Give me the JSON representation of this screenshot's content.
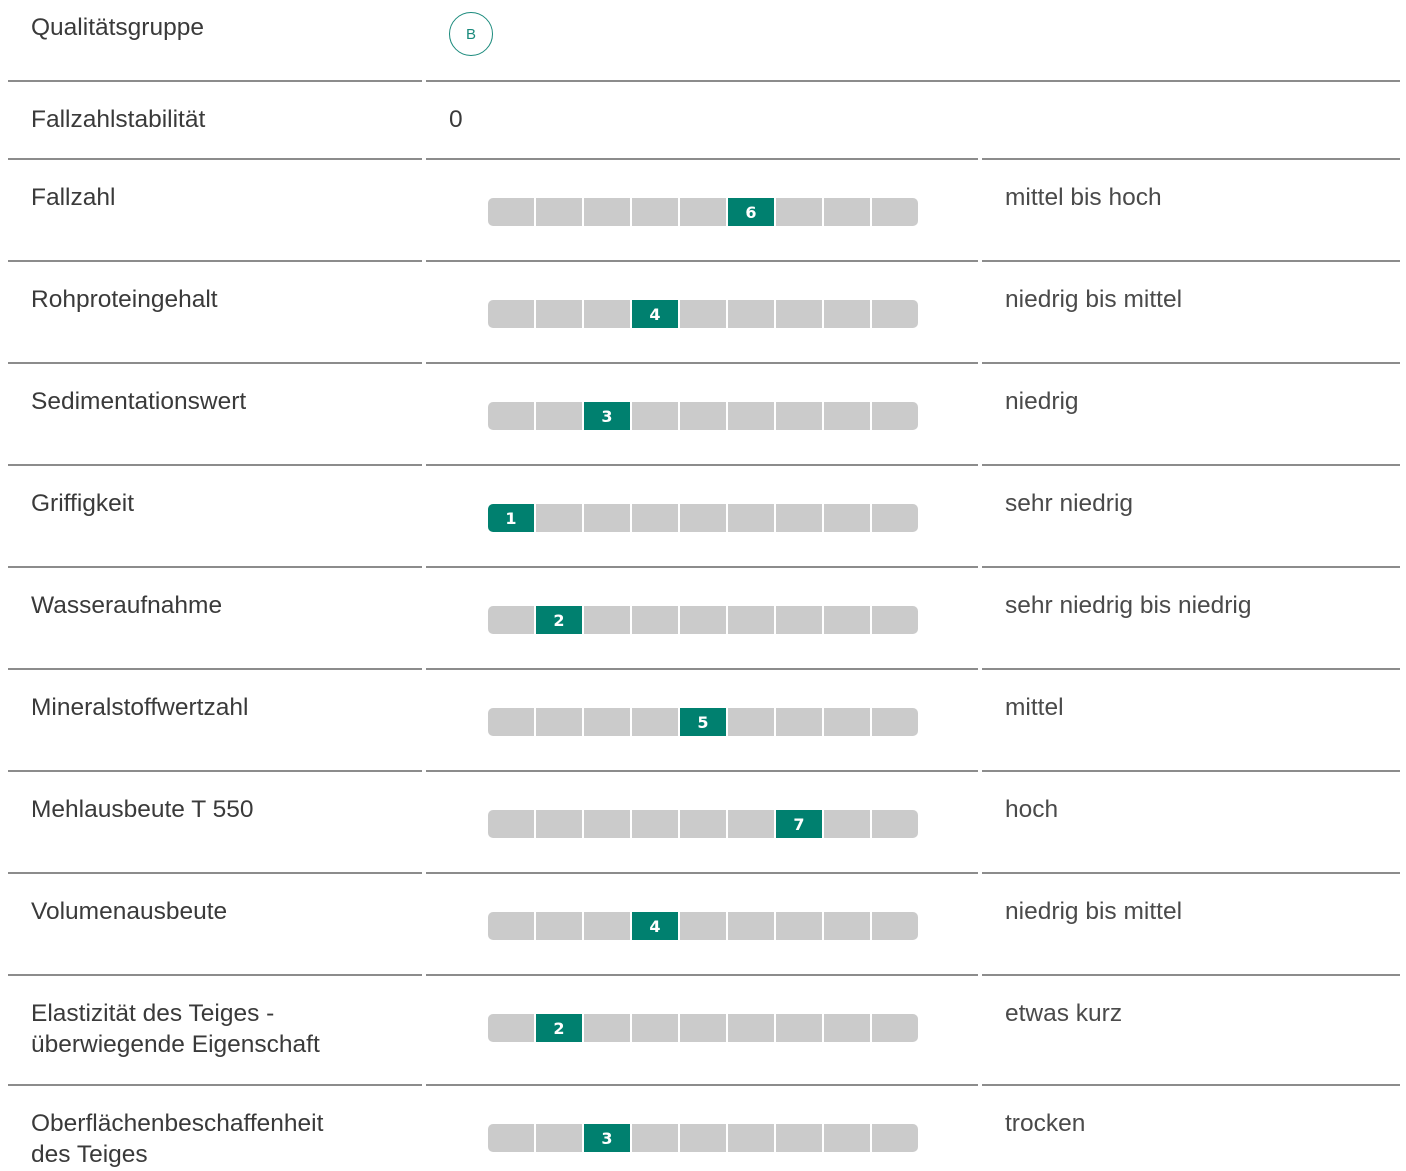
{
  "accent_color": "#00806f",
  "scale_max": 9,
  "rows": [
    {
      "label": "Qualitätsgruppe",
      "badge": "B"
    },
    {
      "label": "Fallzahlstabilität",
      "value": "0"
    },
    {
      "label": "Fallzahl",
      "score": 6,
      "score_label": "6",
      "desc": "mittel bis hoch"
    },
    {
      "label": "Rohproteingehalt",
      "score": 4,
      "score_label": "4",
      "desc": "niedrig bis mittel"
    },
    {
      "label": "Sedimentationswert",
      "score": 3,
      "score_label": "3",
      "desc": "niedrig"
    },
    {
      "label": "Griffigkeit",
      "score": 1,
      "score_label": "1",
      "desc": "sehr niedrig"
    },
    {
      "label": "Wasseraufnahme",
      "score": 2,
      "score_label": "2",
      "desc": "sehr niedrig bis niedrig"
    },
    {
      "label": "Mineralstoffwertzahl",
      "score": 5,
      "score_label": "5",
      "desc": "mittel"
    },
    {
      "label": "Mehlausbeute T 550",
      "score": 7,
      "score_label": "7",
      "desc": "hoch"
    },
    {
      "label": "Volumenausbeute",
      "score": 4,
      "score_label": "4",
      "desc": "niedrig bis mittel"
    },
    {
      "label_lines": [
        "Elastizität des Teiges -",
        "überwiegende Eigenschaft"
      ],
      "score": 2,
      "score_label": "2",
      "desc": "etwas kurz"
    },
    {
      "label_lines": [
        "Oberflächenbeschaffenheit",
        "des Teiges"
      ],
      "score": 3,
      "score_label": "3",
      "desc": "trocken"
    }
  ]
}
